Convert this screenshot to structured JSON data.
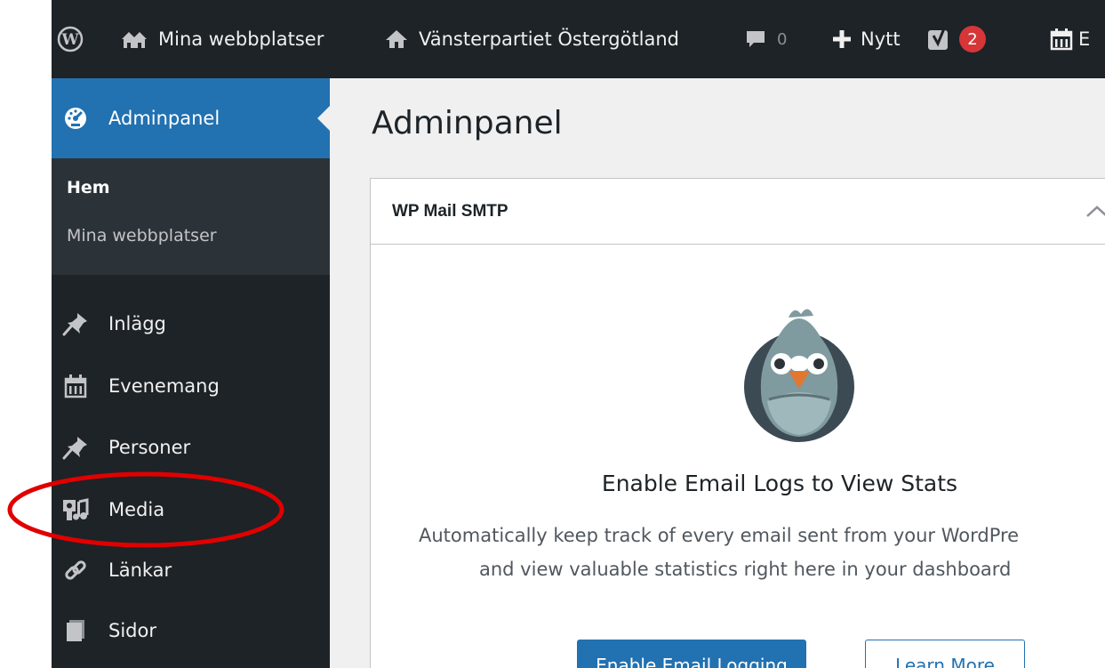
{
  "colors": {
    "adminbar_bg": "#1d2327",
    "sidebar_bg": "#1d2327",
    "submenu_bg": "#2c3338",
    "accent": "#2271b1",
    "badge": "#d63638",
    "highlight_ring": "#e00000"
  },
  "adminbar": {
    "wp_logo_icon": "wordpress-logo-icon",
    "my_sites_label": "Mina webbplatser",
    "site_name": "Vänsterpartiet Östergötland",
    "comments_count": "0",
    "new_label": "Nytt",
    "yoast_notifications": "2",
    "events_initial": "E"
  },
  "sidebar": {
    "active": {
      "label": "Adminpanel",
      "icon": "dashboard-icon"
    },
    "submenu": [
      {
        "label": "Hem"
      },
      {
        "label": "Mina webbplatser"
      }
    ],
    "items": [
      {
        "label": "Inlägg",
        "icon": "pushpin-icon"
      },
      {
        "label": "Evenemang",
        "icon": "calendar-icon"
      },
      {
        "label": "Personer",
        "icon": "pushpin-icon"
      },
      {
        "label": "Media",
        "icon": "media-icon"
      },
      {
        "label": "Länkar",
        "icon": "link-icon"
      },
      {
        "label": "Sidor",
        "icon": "page-icon"
      }
    ]
  },
  "main": {
    "page_title": "Adminpanel",
    "widget": {
      "title": "WP Mail SMTP",
      "empty_title": "Enable Email Logs to View Stats",
      "desc_line1": "Automatically keep track of every email sent from your WordPre",
      "desc_line2": "and view valuable statistics right here in your dashboard",
      "primary_button": "Enable Email Logging",
      "secondary_button": "Learn More"
    }
  }
}
